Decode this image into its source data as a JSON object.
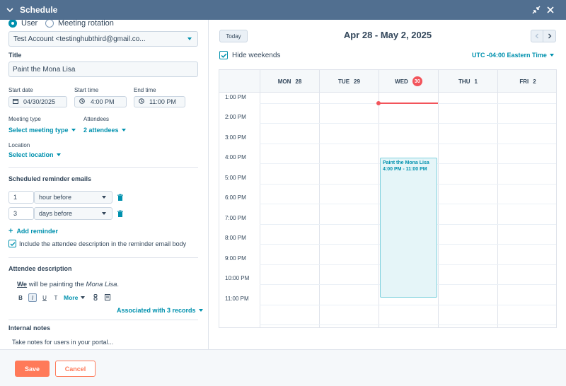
{
  "header": {
    "title": "Schedule"
  },
  "left": {
    "radio_user": "User",
    "radio_rotation": "Meeting rotation",
    "account": "Test Account <testinghubthird@gmail.co...",
    "title_label": "Title",
    "title_value": "Paint the Mona Lisa",
    "start_date_label": "Start date",
    "start_date": "04/30/2025",
    "start_time_label": "Start time",
    "start_time": "4:00 PM",
    "end_time_label": "End time",
    "end_time": "11:00 PM",
    "meeting_type_label": "Meeting type",
    "meeting_type_value": "Select meeting type",
    "attendees_label": "Attendees",
    "attendees_value": "2 attendees",
    "location_label": "Location",
    "location_value": "Select location",
    "reminders_heading": "Scheduled reminder emails",
    "reminders": [
      {
        "num": "1",
        "unit": "hour before"
      },
      {
        "num": "3",
        "unit": "days before"
      }
    ],
    "add_reminder": "Add reminder",
    "include_desc": "Include the attendee description in the reminder email body",
    "attendee_desc_heading": "Attendee description",
    "desc_we": "We",
    "desc_mid": " will be painting the ",
    "desc_italic": "Mona Lisa",
    "desc_end": ".",
    "toolbar": {
      "bold": "B",
      "italic": "I",
      "underline": "U",
      "clear": "T",
      "more": "More"
    },
    "associated": "Associated with 3 records",
    "internal_notes_heading": "Internal notes",
    "internal_notes_placeholder": "Take notes for users in your portal..."
  },
  "calendar": {
    "today_btn": "Today",
    "range": "Apr 28 - May 2, 2025",
    "hide_weekends": "Hide weekends",
    "timezone": "UTC -04:00 Eastern Time",
    "days": [
      {
        "name": "MON",
        "num": "28"
      },
      {
        "name": "TUE",
        "num": "29"
      },
      {
        "name": "WED",
        "num": "30"
      },
      {
        "name": "THU",
        "num": "1"
      },
      {
        "name": "FRI",
        "num": "2"
      }
    ],
    "hours": [
      "1:00 PM",
      "2:00 PM",
      "3:00 PM",
      "4:00 PM",
      "5:00 PM",
      "6:00 PM",
      "7:00 PM",
      "8:00 PM",
      "9:00 PM",
      "10:00 PM",
      "11:00 PM"
    ],
    "event": {
      "title": "Paint the Mona Lisa",
      "time": "4:00 PM - 11:00 PM"
    }
  },
  "footer": {
    "save": "Save",
    "cancel": "Cancel"
  },
  "colors": {
    "header": "#516f90",
    "accent": "#0091ae",
    "primary": "#ff7a59",
    "today": "#f2545b"
  }
}
